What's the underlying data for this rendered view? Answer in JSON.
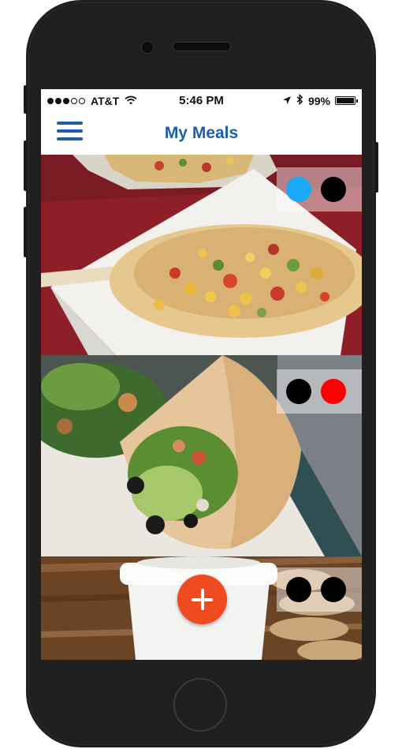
{
  "status_bar": {
    "carrier": "AT&T",
    "time": "5:46 PM",
    "battery_text": "99%",
    "battery_level": 0.99,
    "signal_dots": [
      true,
      true,
      true,
      false,
      false
    ],
    "icons": [
      "wifi-icon",
      "location-arrow-icon",
      "bluetooth-icon",
      "battery-icon"
    ]
  },
  "nav": {
    "title": "My Meals",
    "menu_icon": "hamburger-menu-icon",
    "accent_color": "#1c5ea8"
  },
  "meals": [
    {
      "photo": "tacos-photo",
      "dot_colors": [
        "#19a9f6",
        "#000000"
      ]
    },
    {
      "photo": "pita-wrap-photo",
      "dot_colors": [
        "#000000",
        "#ff0000"
      ]
    },
    {
      "photo": "coffee-cup-photo",
      "dot_colors": [
        "#000000",
        "#000000"
      ]
    }
  ],
  "fab": {
    "icon": "plus-icon",
    "color": "#f04a1f"
  }
}
